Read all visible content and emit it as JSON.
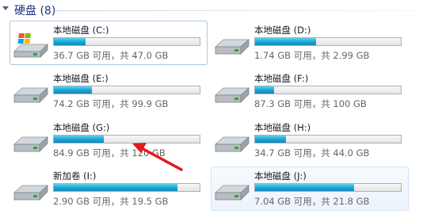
{
  "group": {
    "title": "硬盘 (8)"
  },
  "drives": [
    {
      "label": "本地磁盘 (C:)",
      "free_text": "36.7 GB 可用，共 47.0 GB",
      "used_fraction": 0.22,
      "icon": "windows-drive-icon"
    },
    {
      "label": "本地磁盘 (D:)",
      "free_text": "1.74 GB 可用，共 2.99 GB",
      "used_fraction": 0.42,
      "icon": "hard-drive-icon"
    },
    {
      "label": "本地磁盘 (E:)",
      "free_text": "74.2 GB 可用，共 99.9 GB",
      "used_fraction": 0.26,
      "icon": "hard-drive-icon"
    },
    {
      "label": "本地磁盘 (F:)",
      "free_text": "87.3 GB 可用，共 100 GB",
      "used_fraction": 0.13,
      "icon": "hard-drive-icon"
    },
    {
      "label": "本地磁盘 (G:)",
      "free_text": "84.9 GB 可用，共 120 GB",
      "used_fraction": 0.34,
      "icon": "hard-drive-icon"
    },
    {
      "label": "本地磁盘 (H:)",
      "free_text": "34.7 GB 可用，共 44.0 GB",
      "used_fraction": 0.21,
      "icon": "hard-drive-icon"
    },
    {
      "label": "新加卷 (I:)",
      "free_text": "2.90 GB 可用，共 19.5 GB",
      "used_fraction": 0.85,
      "icon": "hard-drive-icon"
    },
    {
      "label": "本地磁盘 (J:)",
      "free_text": "7.04 GB 可用，共 21.8 GB",
      "used_fraction": 0.68,
      "icon": "hard-drive-icon"
    }
  ],
  "colors": {
    "bar_fill": "#26a8d8",
    "arrow": "#e21b1b",
    "header_text": "#1e3287"
  }
}
